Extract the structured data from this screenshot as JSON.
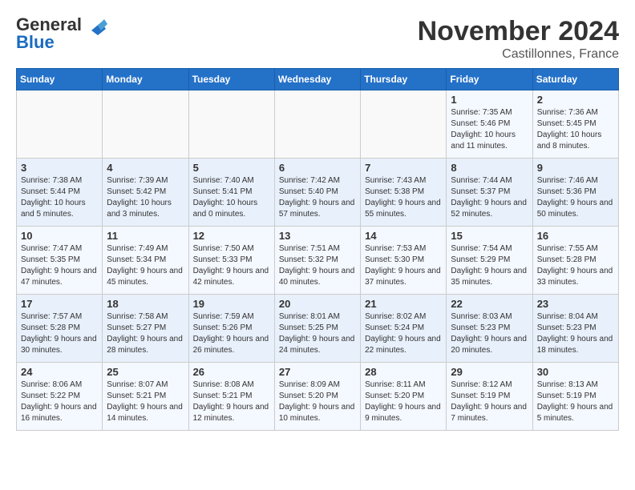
{
  "header": {
    "logo_general": "General",
    "logo_blue": "Blue",
    "month_title": "November 2024",
    "location": "Castillonnes, France"
  },
  "days_of_week": [
    "Sunday",
    "Monday",
    "Tuesday",
    "Wednesday",
    "Thursday",
    "Friday",
    "Saturday"
  ],
  "weeks": [
    [
      {
        "day": "",
        "info": ""
      },
      {
        "day": "",
        "info": ""
      },
      {
        "day": "",
        "info": ""
      },
      {
        "day": "",
        "info": ""
      },
      {
        "day": "",
        "info": ""
      },
      {
        "day": "1",
        "info": "Sunrise: 7:35 AM\nSunset: 5:46 PM\nDaylight: 10 hours and 11 minutes."
      },
      {
        "day": "2",
        "info": "Sunrise: 7:36 AM\nSunset: 5:45 PM\nDaylight: 10 hours and 8 minutes."
      }
    ],
    [
      {
        "day": "3",
        "info": "Sunrise: 7:38 AM\nSunset: 5:44 PM\nDaylight: 10 hours and 5 minutes."
      },
      {
        "day": "4",
        "info": "Sunrise: 7:39 AM\nSunset: 5:42 PM\nDaylight: 10 hours and 3 minutes."
      },
      {
        "day": "5",
        "info": "Sunrise: 7:40 AM\nSunset: 5:41 PM\nDaylight: 10 hours and 0 minutes."
      },
      {
        "day": "6",
        "info": "Sunrise: 7:42 AM\nSunset: 5:40 PM\nDaylight: 9 hours and 57 minutes."
      },
      {
        "day": "7",
        "info": "Sunrise: 7:43 AM\nSunset: 5:38 PM\nDaylight: 9 hours and 55 minutes."
      },
      {
        "day": "8",
        "info": "Sunrise: 7:44 AM\nSunset: 5:37 PM\nDaylight: 9 hours and 52 minutes."
      },
      {
        "day": "9",
        "info": "Sunrise: 7:46 AM\nSunset: 5:36 PM\nDaylight: 9 hours and 50 minutes."
      }
    ],
    [
      {
        "day": "10",
        "info": "Sunrise: 7:47 AM\nSunset: 5:35 PM\nDaylight: 9 hours and 47 minutes."
      },
      {
        "day": "11",
        "info": "Sunrise: 7:49 AM\nSunset: 5:34 PM\nDaylight: 9 hours and 45 minutes."
      },
      {
        "day": "12",
        "info": "Sunrise: 7:50 AM\nSunset: 5:33 PM\nDaylight: 9 hours and 42 minutes."
      },
      {
        "day": "13",
        "info": "Sunrise: 7:51 AM\nSunset: 5:32 PM\nDaylight: 9 hours and 40 minutes."
      },
      {
        "day": "14",
        "info": "Sunrise: 7:53 AM\nSunset: 5:30 PM\nDaylight: 9 hours and 37 minutes."
      },
      {
        "day": "15",
        "info": "Sunrise: 7:54 AM\nSunset: 5:29 PM\nDaylight: 9 hours and 35 minutes."
      },
      {
        "day": "16",
        "info": "Sunrise: 7:55 AM\nSunset: 5:28 PM\nDaylight: 9 hours and 33 minutes."
      }
    ],
    [
      {
        "day": "17",
        "info": "Sunrise: 7:57 AM\nSunset: 5:28 PM\nDaylight: 9 hours and 30 minutes."
      },
      {
        "day": "18",
        "info": "Sunrise: 7:58 AM\nSunset: 5:27 PM\nDaylight: 9 hours and 28 minutes."
      },
      {
        "day": "19",
        "info": "Sunrise: 7:59 AM\nSunset: 5:26 PM\nDaylight: 9 hours and 26 minutes."
      },
      {
        "day": "20",
        "info": "Sunrise: 8:01 AM\nSunset: 5:25 PM\nDaylight: 9 hours and 24 minutes."
      },
      {
        "day": "21",
        "info": "Sunrise: 8:02 AM\nSunset: 5:24 PM\nDaylight: 9 hours and 22 minutes."
      },
      {
        "day": "22",
        "info": "Sunrise: 8:03 AM\nSunset: 5:23 PM\nDaylight: 9 hours and 20 minutes."
      },
      {
        "day": "23",
        "info": "Sunrise: 8:04 AM\nSunset: 5:23 PM\nDaylight: 9 hours and 18 minutes."
      }
    ],
    [
      {
        "day": "24",
        "info": "Sunrise: 8:06 AM\nSunset: 5:22 PM\nDaylight: 9 hours and 16 minutes."
      },
      {
        "day": "25",
        "info": "Sunrise: 8:07 AM\nSunset: 5:21 PM\nDaylight: 9 hours and 14 minutes."
      },
      {
        "day": "26",
        "info": "Sunrise: 8:08 AM\nSunset: 5:21 PM\nDaylight: 9 hours and 12 minutes."
      },
      {
        "day": "27",
        "info": "Sunrise: 8:09 AM\nSunset: 5:20 PM\nDaylight: 9 hours and 10 minutes."
      },
      {
        "day": "28",
        "info": "Sunrise: 8:11 AM\nSunset: 5:20 PM\nDaylight: 9 hours and 9 minutes."
      },
      {
        "day": "29",
        "info": "Sunrise: 8:12 AM\nSunset: 5:19 PM\nDaylight: 9 hours and 7 minutes."
      },
      {
        "day": "30",
        "info": "Sunrise: 8:13 AM\nSunset: 5:19 PM\nDaylight: 9 hours and 5 minutes."
      }
    ]
  ]
}
